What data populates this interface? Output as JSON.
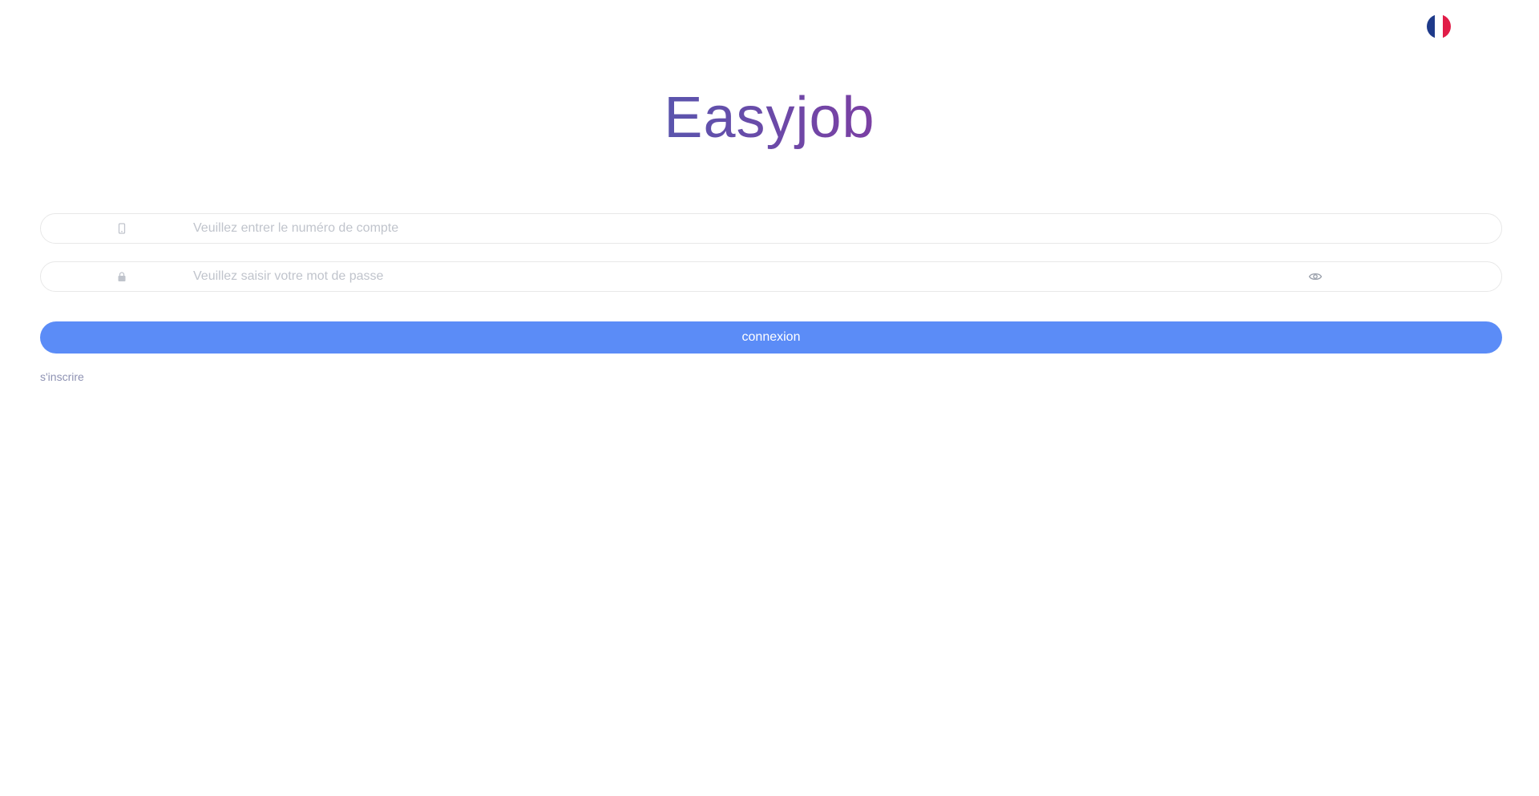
{
  "header": {
    "language_flag_colors": [
      "#1e3a8a",
      "#ffffff",
      "#e11d48"
    ]
  },
  "brand": {
    "title": "Easyjob",
    "gradient_start": "#5a55ad",
    "gradient_end": "#7b3fa3"
  },
  "form": {
    "account": {
      "placeholder": "Veuillez entrer le numéro de compte",
      "value": "",
      "icon": "phone-icon"
    },
    "password": {
      "placeholder": "Veuillez saisir votre mot de passe",
      "value": "",
      "icon": "lock-icon",
      "toggle_icon": "eye-icon"
    },
    "login_label": "connexion",
    "login_color": "#5b8cf7",
    "register_label": "s'inscrire"
  }
}
